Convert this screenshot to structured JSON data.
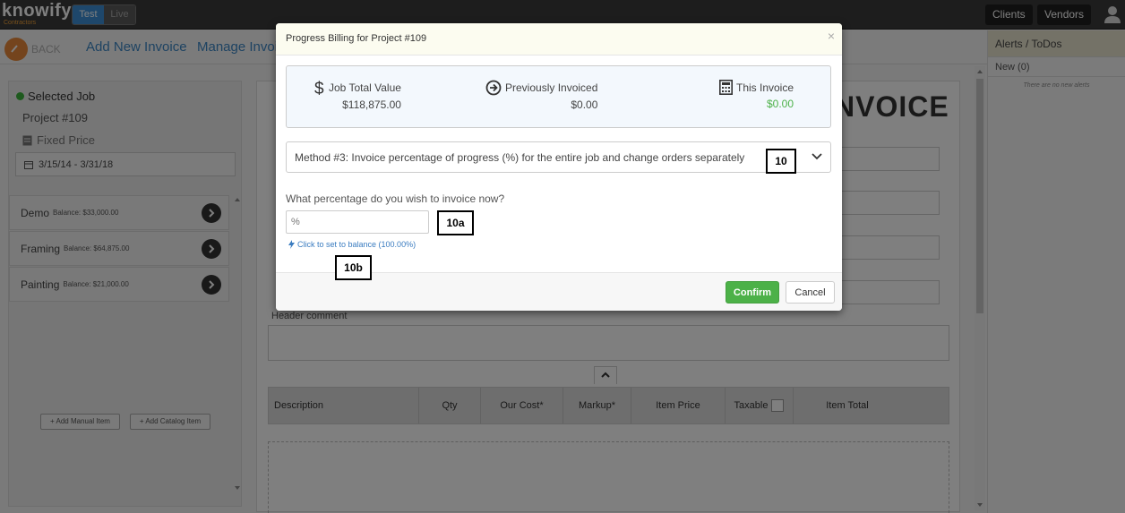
{
  "topbar": {
    "logo_text": "knowify",
    "logo_sub": "Contractors",
    "env_test": "Test",
    "env_live": "Live",
    "clients_label": "Clients",
    "vendors_label": "Vendors"
  },
  "subhead": {
    "back_label": "BACK",
    "nav": [
      "Add New Invoice",
      "Manage Invoic"
    ]
  },
  "left_panel": {
    "selected_job_label": "Selected Job",
    "project": "Project #109",
    "contract_type": "Fixed Price",
    "date_range": "3/15/14 - 3/31/18",
    "phases": [
      {
        "name": "Demo",
        "balance": "Balance: $33,000.00"
      },
      {
        "name": "Framing",
        "balance": "Balance: $64,875.00"
      },
      {
        "name": "Painting",
        "balance": "Balance: $21,000.00"
      }
    ],
    "add_manual": "+ Add Manual Item",
    "add_catalog": "+ Add Catalog Item"
  },
  "invoice": {
    "title": "NVOICE",
    "header_comment_label": "Header comment",
    "columns": [
      "Description",
      "Qty",
      "Our Cost*",
      "Markup*",
      "Item Price",
      "Taxable",
      "Item Total"
    ]
  },
  "alerts": {
    "title": "Alerts / ToDos",
    "new_label": "New (0)",
    "empty": "There are no new alerts"
  },
  "modal": {
    "title": "Progress Billing for Project #109",
    "close": "×",
    "summary": {
      "job_total_label": "Job Total Value",
      "job_total_value": "$118,875.00",
      "prev_label": "Previously Invoiced",
      "prev_value": "$0.00",
      "this_label": "This Invoice",
      "this_value": "$0.00"
    },
    "method": "Method #3: Invoice percentage of progress (%) for the entire job and change orders separately",
    "question": "What percentage do you wish to invoice now?",
    "percent_placeholder": "%",
    "balance_link": "Click to set to balance (100.00%)",
    "confirm": "Confirm",
    "cancel": "Cancel"
  },
  "callouts": {
    "c10": "10",
    "c10a": "10a",
    "c10b": "10b"
  },
  "colors": {
    "accent_blue": "#3c86c5",
    "confirm_green": "#4cb148",
    "topbar": "#3a3a3a"
  }
}
